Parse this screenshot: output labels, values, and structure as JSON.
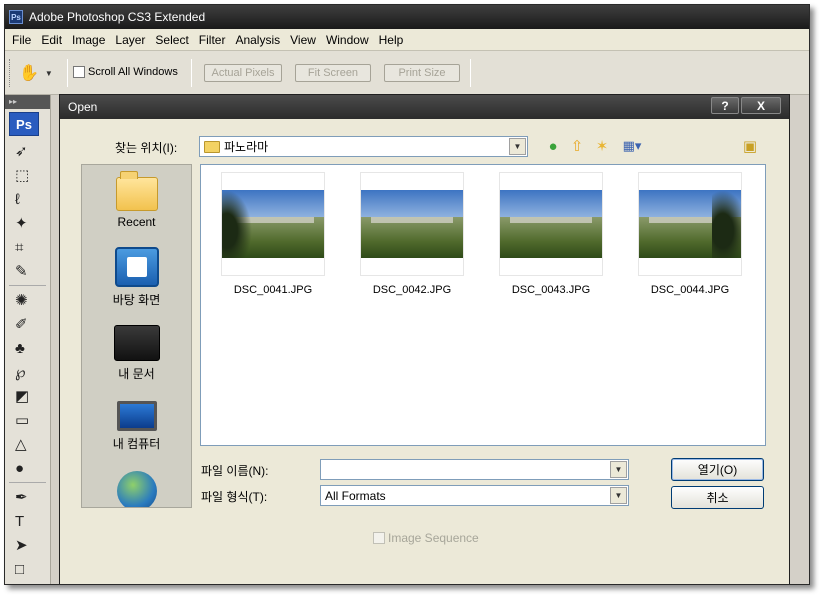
{
  "app": {
    "title": "Adobe Photoshop CS3 Extended",
    "logo": "Ps"
  },
  "menu": [
    "File",
    "Edit",
    "Image",
    "Layer",
    "Select",
    "Filter",
    "Analysis",
    "View",
    "Window",
    "Help"
  ],
  "options": {
    "scroll_all_windows": "Scroll All Windows",
    "actual_pixels": "Actual Pixels",
    "fit_screen": "Fit Screen",
    "print_size": "Print Size"
  },
  "toolbox": {
    "badge": "Ps",
    "header": "▸▸"
  },
  "dialog": {
    "title": "Open",
    "help_btn": "?",
    "close_btn": "X",
    "look_in_label": "찾는 위치(I):",
    "look_in_value": "파노라마",
    "places": [
      {
        "label": "Recent",
        "icon": "recent-folder-icon"
      },
      {
        "label": "바탕 화면",
        "icon": "desktop-icon"
      },
      {
        "label": "내 문서",
        "icon": "documents-icon"
      },
      {
        "label": "내 컴퓨터",
        "icon": "computer-icon"
      },
      {
        "label": "",
        "icon": "network-icon"
      }
    ],
    "files": [
      {
        "name": "DSC_0041.JPG"
      },
      {
        "name": "DSC_0042.JPG"
      },
      {
        "name": "DSC_0043.JPG"
      },
      {
        "name": "DSC_0044.JPG"
      }
    ],
    "filename_label": "파일 이름(N):",
    "filename_value": "",
    "filetype_label": "파일 형식(T):",
    "filetype_value": "All Formats",
    "open_btn": "열기(O)",
    "cancel_btn": "취소",
    "image_sequence": "Image Sequence"
  }
}
